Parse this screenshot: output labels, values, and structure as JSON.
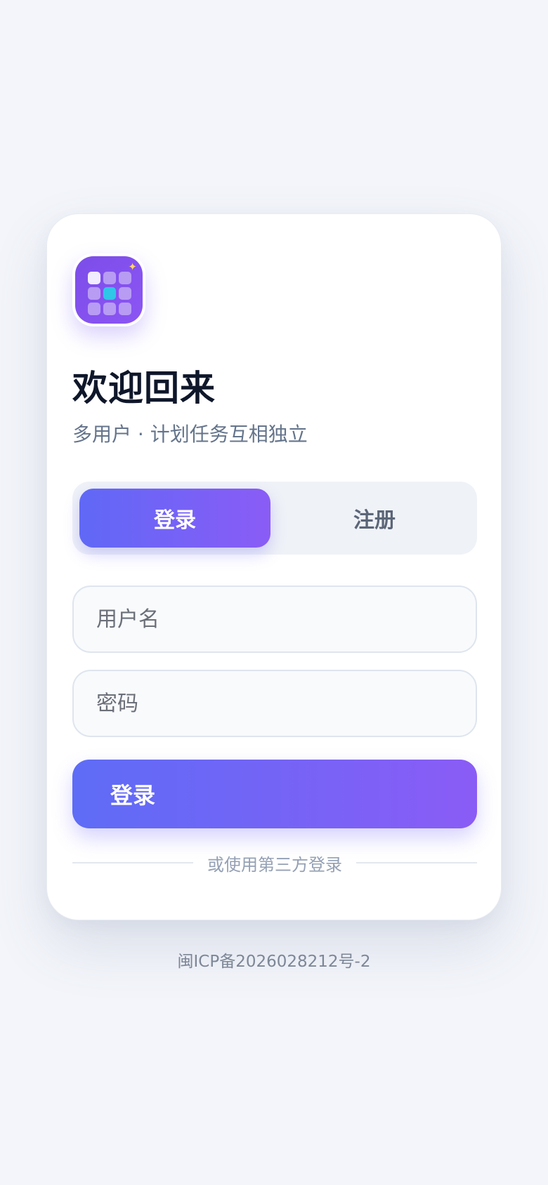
{
  "app": {
    "icon_name": "app-grid-icon",
    "brand_gradient": [
      "#7c4de9",
      "#8c55f4"
    ],
    "accent_color": "#2fc6e8"
  },
  "header": {
    "title": "欢迎回来",
    "subtitle": "多用户 · 计划任务互相独立"
  },
  "tabs": [
    {
      "label": "登录",
      "active": true
    },
    {
      "label": "注册",
      "active": false
    }
  ],
  "form": {
    "username_placeholder": "用户名",
    "username_value": "",
    "password_placeholder": "密码",
    "password_value": "",
    "submit_label": "登录"
  },
  "divider_text": "或使用第三方登录",
  "footer": {
    "icp": "闽ICP备2026028212号-2"
  }
}
